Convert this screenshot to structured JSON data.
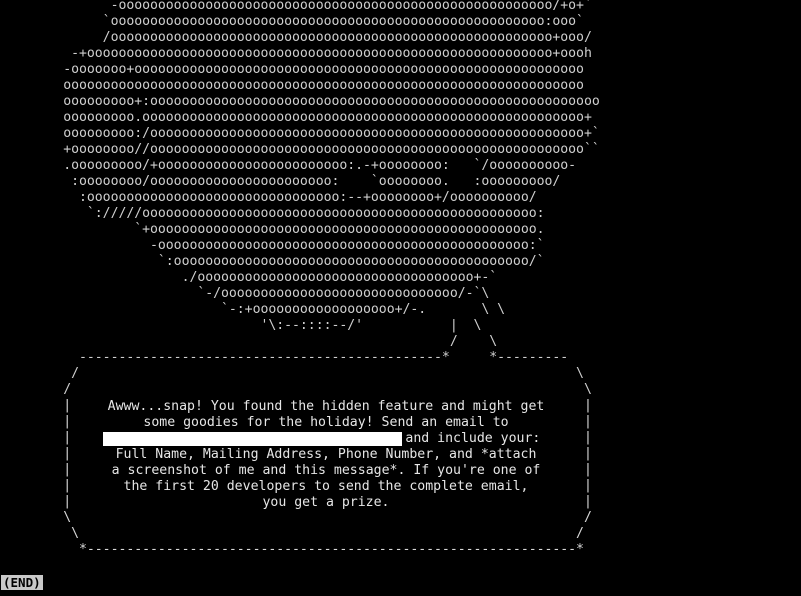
{
  "art_lines": [
    "             -ooooooooooooooooooooooooooooooooooooooooooooooooooooooo/+o+`",
    "            `ooooooooooooooooooooooooooooooooooooooooooooooooooooooo:ooo`",
    "            /oooooooooooooooooooooooooooooooooooooooooooooooooooooooo+ooo/",
    "        -+ooooooooooooooooooooooooooooooooooooooooooooooooooooooooooo+oooh",
    "       -ooooooo+ooooooooooooooooooooooooooooooooooooooooooooooooooooooooo",
    "       oooooooooooooooooooooooooooooooooooooooooooooooooooooooooooooooooo",
    "       ooooooooo+:ooooooooooooooooooooooooooooooooooooooooooooooooooooooooo",
    "       ooooooooo.oooooooooooooooooooooooooooooooooooooooooooooooooooooooo+",
    "       ooooooooo:/ooooooooooooooooooooooooooooooooooooooooooooooooooooooo+`",
    "       +oooooooo//ooooooooooooooooooooooooooooooooooooooooooooooooooooooo``",
    "       .ooooooooo/+oooooooooooooooooooooooo:.-+oooooooo:   `/oooooooooo-",
    "        :oooooooo/ooooooooooooooooooooooo:    `oooooooo.   :ooooooooo/",
    "         :oooooooooooooooooooooooooooooooo:--+oooooooo+/oooooooooo/",
    "          `://///oooooooooooooooooooooooooooooooooooooooooooooooooo:",
    "                `+ooooooooooooooooooooooooooooooooooooooooooooooooo.",
    "                  -ooooooooooooooooooooooooooooooooooooooooooooooo:`",
    "                   `:ooooooooooooooooooooooooooooooooooooooooooooo/`",
    "                      ./ooooooooooooooooooooooooooooooooooo+-`",
    "                        `-/oooooooooooooooooooooooooooooo/-`\\",
    "                           `-:+oooooooooooooooooo+/-.       \\ \\",
    "                                '\\:--::::--/'           |  \\",
    "                                                        /    \\",
    "         ----------------------------------------------*     *---------",
    "        /                                                               \\",
    "       /                                                                 \\"
  ],
  "box_lines": [
    "       |                                                                 |",
    "       |                                                                 |",
    "       |                                                                 |",
    "       |                                                                 |",
    "       |                                                                 |",
    "       |                                                                 |",
    "       |                                                                 |",
    "       \\                                                                 /",
    "        \\                                                               /",
    "         *--------------------------------------------------------------*"
  ],
  "message": {
    "line1": "Awww...snap! You found the hidden feature and might get",
    "line2": "some goodies for the holiday! Send an email to",
    "line3": "                                     and include your:",
    "line4": "Full Name, Mailing Address, Phone Number, and *attach",
    "line5": "a screenshot of me and this message*. If you're one of",
    "line6": "the first 20 developers to send the complete email,",
    "line7": "you get a prize."
  },
  "pager_status": "(END)"
}
